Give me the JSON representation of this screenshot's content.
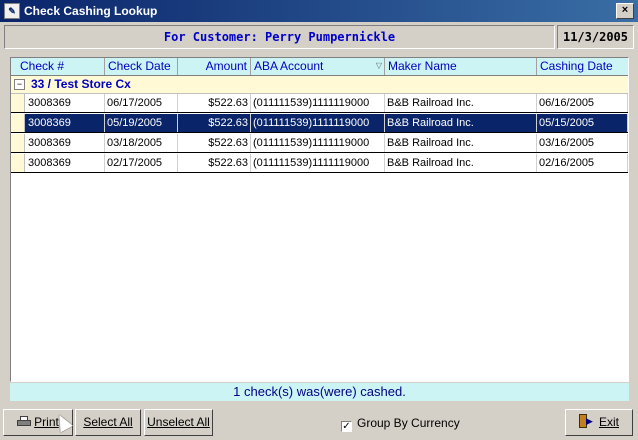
{
  "window": {
    "title": "Check Cashing Lookup",
    "icon": "check-document-icon",
    "close_glyph": "×"
  },
  "header": {
    "customer_label": "For Customer: Perry Pumpernickle",
    "date": "11/3/2005"
  },
  "grid": {
    "columns": [
      "Check #",
      "Check Date",
      "Amount",
      "ABA Account",
      "Maker Name",
      "Cashing Date"
    ],
    "sort_indicator": "▽",
    "group": {
      "toggle": "−",
      "label": "33 / Test Store Cx"
    },
    "rows": [
      {
        "check": "3008369",
        "check_date": "06/17/2005",
        "amount": "$522.63",
        "aba": "(011111539)1111119000",
        "maker": "B&B Railroad Inc.",
        "cashing_date": "06/16/2005",
        "selected": false
      },
      {
        "check": "3008369",
        "check_date": "05/19/2005",
        "amount": "$522.63",
        "aba": "(011111539)1111119000",
        "maker": "B&B Railroad Inc.",
        "cashing_date": "05/15/2005",
        "selected": true
      },
      {
        "check": "3008369",
        "check_date": "03/18/2005",
        "amount": "$522.63",
        "aba": "(011111539)1111119000",
        "maker": "B&B Railroad Inc.",
        "cashing_date": "03/16/2005",
        "selected": false
      },
      {
        "check": "3008369",
        "check_date": "02/17/2005",
        "amount": "$522.63",
        "aba": "(011111539)1111119000",
        "maker": "B&B Railroad Inc.",
        "cashing_date": "02/16/2005",
        "selected": false
      }
    ]
  },
  "status": "1 check(s) was(were) cashed.",
  "footer": {
    "print_label": "Print",
    "select_all_label": "Select All",
    "unselect_all_label": "Unselect All",
    "group_by_currency_label": "Group By Currency",
    "group_by_currency_checked": "✓",
    "exit_label": "Exit"
  },
  "colors": {
    "title_bar": "#0a246a",
    "header_bg": "#ccf4f4",
    "group_bg": "#fff9d6",
    "selected_row": "#0a246a",
    "customer_text": "#0000c8"
  }
}
